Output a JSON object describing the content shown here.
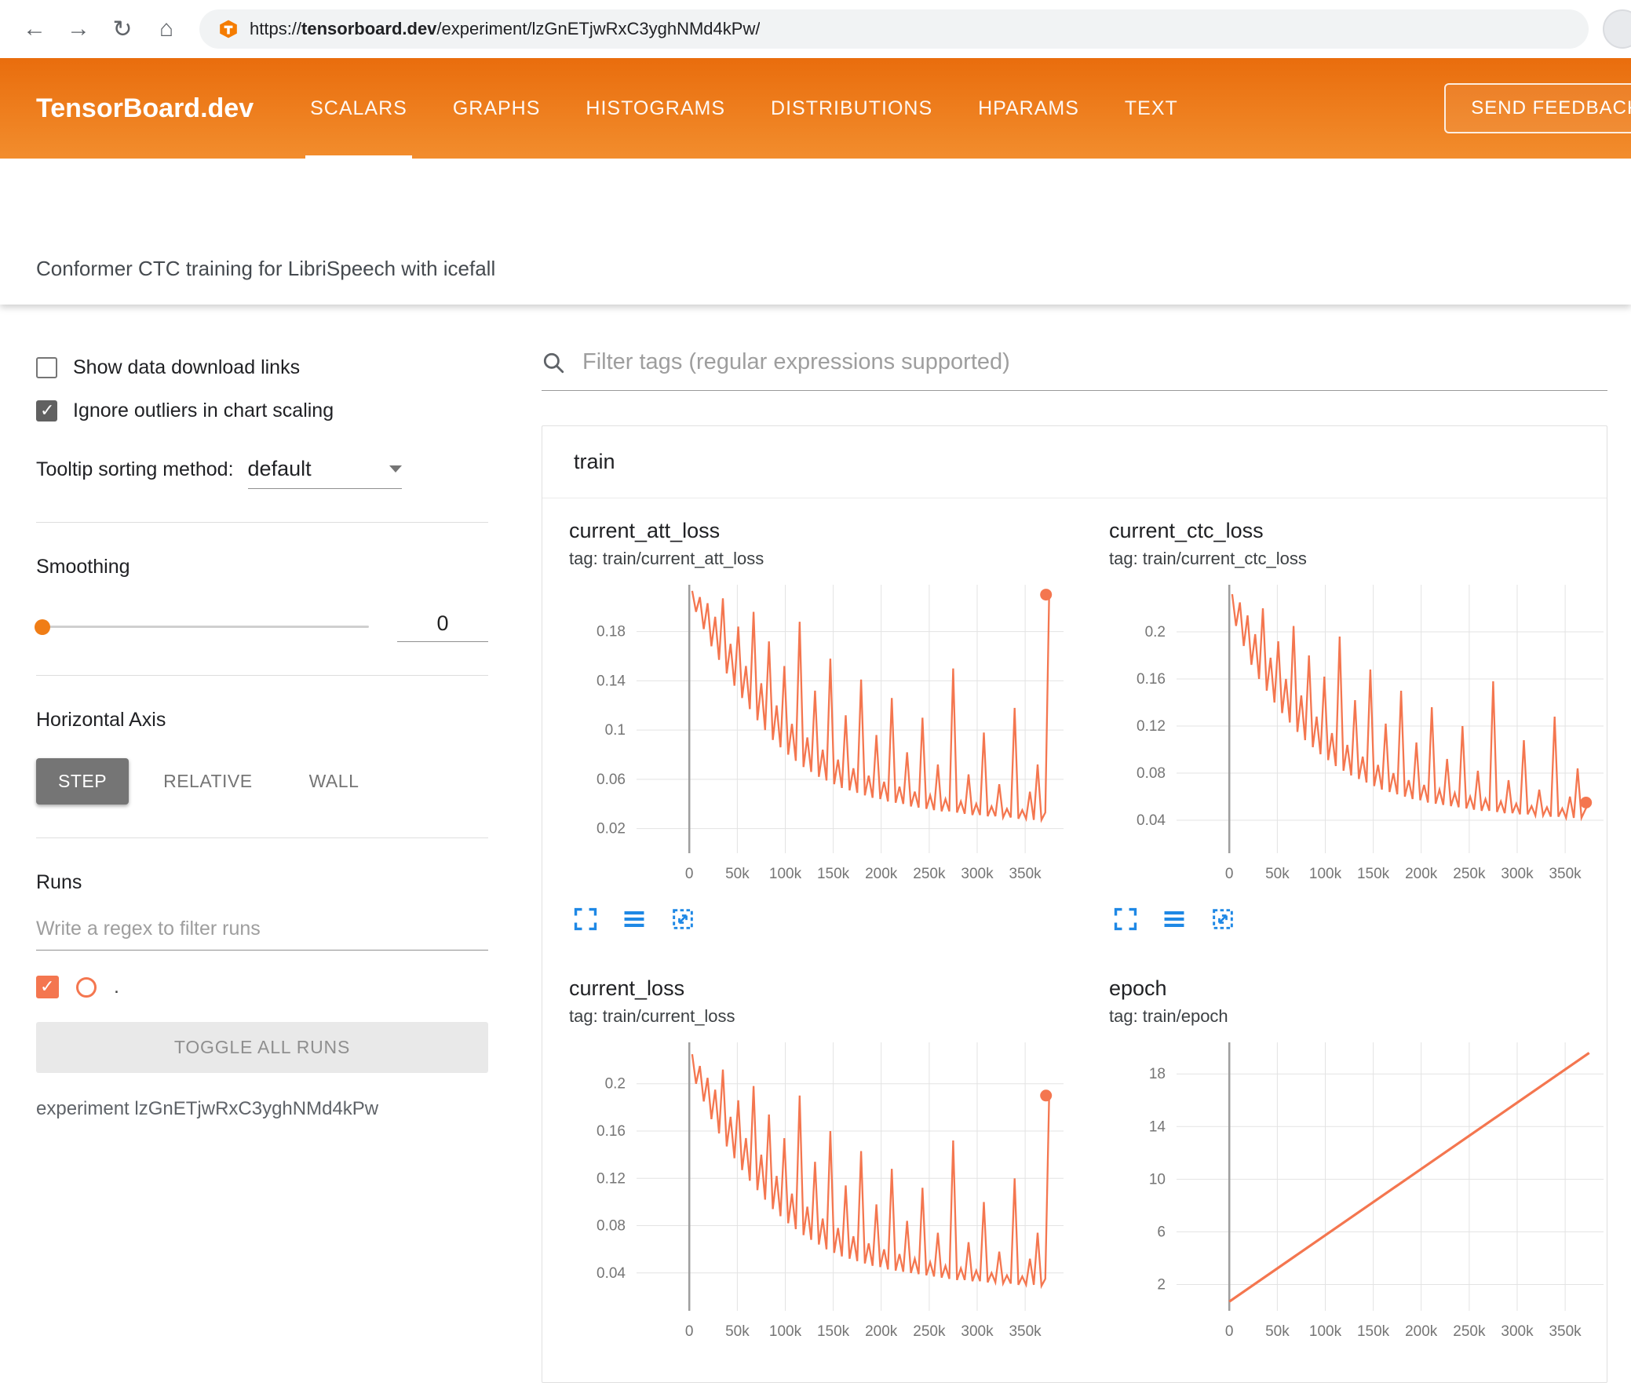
{
  "browser": {
    "back": "back",
    "forward": "forward",
    "reload": "reload",
    "home": "home",
    "url_scheme": "https://",
    "url_domain": "tensorboard.dev",
    "url_path": "/experiment/lzGnETjwRxC3yghNMd4kPw/"
  },
  "header": {
    "logo": "TensorBoard.dev",
    "tabs": [
      "SCALARS",
      "GRAPHS",
      "HISTOGRAMS",
      "DISTRIBUTIONS",
      "HPARAMS",
      "TEXT"
    ],
    "active_tab": "SCALARS",
    "feedback_label": "SEND FEEDBACK"
  },
  "subheader": {
    "title": "Conformer CTC training for LibriSpeech with icefall"
  },
  "sidebar": {
    "show_download_label": "Show data download links",
    "ignore_outliers_label": "Ignore outliers in chart scaling",
    "tooltip_label": "Tooltip sorting method:",
    "tooltip_value": "default",
    "smoothing_label": "Smoothing",
    "smoothing_value": "0",
    "horizontal_axis_label": "Horizontal Axis",
    "axis_buttons": [
      "STEP",
      "RELATIVE",
      "WALL"
    ],
    "active_axis": "STEP",
    "runs_label": "Runs",
    "runs_filter_placeholder": "Write a regex to filter runs",
    "run_item_label": ".",
    "toggle_button_label": "TOGGLE ALL RUNS",
    "experiment_caption": "experiment lzGnETjwRxC3yghNMd4kPw"
  },
  "main": {
    "filter_placeholder": "Filter tags (regular expressions supported)",
    "card_title": "train"
  },
  "colors": {
    "header_top": "#e96d0d",
    "header_bottom": "#f28d2d",
    "accent": "#f07d16",
    "line": "#f4764f",
    "icon_blue": "#1e88e5"
  },
  "chart_data": [
    {
      "type": "line",
      "title": "current_att_loss",
      "subtitle": "tag: train/current_att_loss",
      "x_start": 3000,
      "x_step": 4000,
      "y_values": [
        0.213,
        0.196,
        0.208,
        0.182,
        0.203,
        0.168,
        0.192,
        0.157,
        0.207,
        0.146,
        0.17,
        0.136,
        0.184,
        0.126,
        0.152,
        0.117,
        0.196,
        0.108,
        0.138,
        0.1,
        0.172,
        0.092,
        0.12,
        0.086,
        0.152,
        0.08,
        0.105,
        0.075,
        0.188,
        0.07,
        0.094,
        0.066,
        0.132,
        0.062,
        0.084,
        0.059,
        0.158,
        0.056,
        0.076,
        0.053,
        0.112,
        0.051,
        0.069,
        0.049,
        0.141,
        0.047,
        0.063,
        0.045,
        0.096,
        0.044,
        0.058,
        0.042,
        0.126,
        0.041,
        0.054,
        0.04,
        0.082,
        0.038,
        0.05,
        0.037,
        0.11,
        0.036,
        0.047,
        0.035,
        0.072,
        0.034,
        0.044,
        0.034,
        0.15,
        0.033,
        0.042,
        0.032,
        0.064,
        0.031,
        0.04,
        0.031,
        0.098,
        0.03,
        0.038,
        0.03,
        0.056,
        0.029,
        0.036,
        0.029,
        0.118,
        0.028,
        0.035,
        0.028,
        0.05,
        0.027,
        0.072,
        0.027,
        0.033,
        0.21
      ],
      "x_domain": [
        -55000,
        390000
      ],
      "y_domain": [
        0,
        0.218
      ],
      "x_ticks": {
        "values": [
          0,
          50000,
          100000,
          150000,
          200000,
          250000,
          300000,
          350000
        ],
        "labels": [
          "0",
          "50k",
          "100k",
          "150k",
          "200k",
          "250k",
          "300k",
          "350k"
        ]
      },
      "y_ticks": {
        "values": [
          0.02,
          0.06,
          0.1,
          0.14,
          0.18
        ],
        "labels": [
          "0.02",
          "0.06",
          "0.1",
          "0.14",
          "0.18"
        ]
      },
      "end_dot": true
    },
    {
      "type": "line",
      "title": "current_ctc_loss",
      "subtitle": "tag: train/current_ctc_loss",
      "x_start": 3000,
      "x_step": 4000,
      "y_values": [
        0.232,
        0.205,
        0.225,
        0.188,
        0.214,
        0.172,
        0.198,
        0.16,
        0.22,
        0.15,
        0.178,
        0.14,
        0.192,
        0.131,
        0.16,
        0.123,
        0.205,
        0.115,
        0.146,
        0.108,
        0.18,
        0.102,
        0.128,
        0.096,
        0.162,
        0.091,
        0.114,
        0.086,
        0.196,
        0.082,
        0.104,
        0.078,
        0.142,
        0.075,
        0.094,
        0.072,
        0.168,
        0.069,
        0.087,
        0.066,
        0.122,
        0.064,
        0.08,
        0.062,
        0.15,
        0.06,
        0.074,
        0.058,
        0.106,
        0.057,
        0.07,
        0.055,
        0.136,
        0.054,
        0.066,
        0.053,
        0.092,
        0.052,
        0.063,
        0.051,
        0.12,
        0.05,
        0.06,
        0.049,
        0.082,
        0.048,
        0.058,
        0.048,
        0.158,
        0.047,
        0.056,
        0.046,
        0.074,
        0.046,
        0.054,
        0.045,
        0.108,
        0.045,
        0.052,
        0.044,
        0.066,
        0.044,
        0.051,
        0.043,
        0.128,
        0.043,
        0.05,
        0.042,
        0.06,
        0.042,
        0.084,
        0.042,
        0.049,
        0.055
      ],
      "x_domain": [
        -55000,
        390000
      ],
      "y_domain": [
        0.012,
        0.24
      ],
      "x_ticks": {
        "values": [
          0,
          50000,
          100000,
          150000,
          200000,
          250000,
          300000,
          350000
        ],
        "labels": [
          "0",
          "50k",
          "100k",
          "150k",
          "200k",
          "250k",
          "300k",
          "350k"
        ]
      },
      "y_ticks": {
        "values": [
          0.04,
          0.08,
          0.12,
          0.16,
          0.2
        ],
        "labels": [
          "0.04",
          "0.08",
          "0.12",
          "0.16",
          "0.2"
        ]
      },
      "end_dot": true
    },
    {
      "type": "line",
      "title": "current_loss",
      "subtitle": "tag: train/current_loss",
      "x_start": 3000,
      "x_step": 4000,
      "y_values": [
        0.225,
        0.2,
        0.215,
        0.185,
        0.205,
        0.17,
        0.195,
        0.158,
        0.212,
        0.147,
        0.172,
        0.137,
        0.186,
        0.127,
        0.154,
        0.118,
        0.198,
        0.11,
        0.14,
        0.102,
        0.174,
        0.094,
        0.122,
        0.088,
        0.154,
        0.082,
        0.107,
        0.077,
        0.19,
        0.072,
        0.096,
        0.068,
        0.134,
        0.064,
        0.086,
        0.06,
        0.16,
        0.057,
        0.078,
        0.054,
        0.114,
        0.052,
        0.071,
        0.05,
        0.143,
        0.048,
        0.065,
        0.046,
        0.098,
        0.045,
        0.06,
        0.043,
        0.128,
        0.042,
        0.056,
        0.041,
        0.084,
        0.04,
        0.052,
        0.039,
        0.112,
        0.038,
        0.049,
        0.037,
        0.074,
        0.036,
        0.046,
        0.035,
        0.152,
        0.034,
        0.044,
        0.034,
        0.066,
        0.033,
        0.042,
        0.033,
        0.1,
        0.032,
        0.04,
        0.032,
        0.058,
        0.031,
        0.038,
        0.031,
        0.12,
        0.03,
        0.037,
        0.03,
        0.052,
        0.03,
        0.074,
        0.029,
        0.035,
        0.19
      ],
      "x_domain": [
        -55000,
        390000
      ],
      "y_domain": [
        0.008,
        0.235
      ],
      "x_ticks": {
        "values": [
          0,
          50000,
          100000,
          150000,
          200000,
          250000,
          300000,
          350000
        ],
        "labels": [
          "0",
          "50k",
          "100k",
          "150k",
          "200k",
          "250k",
          "300k",
          "350k"
        ]
      },
      "y_ticks": {
        "values": [
          0.04,
          0.08,
          0.12,
          0.16,
          0.2
        ],
        "labels": [
          "0.04",
          "0.08",
          "0.12",
          "0.16",
          "0.2"
        ]
      },
      "end_dot": true
    },
    {
      "type": "line",
      "title": "epoch",
      "subtitle": "tag: train/epoch",
      "x_start": 0,
      "x_step": 375000,
      "y_values": [
        0.7,
        19.6
      ],
      "x_domain": [
        -55000,
        390000
      ],
      "y_domain": [
        0,
        20.4
      ],
      "x_ticks": {
        "values": [
          0,
          50000,
          100000,
          150000,
          200000,
          250000,
          300000,
          350000
        ],
        "labels": [
          "0",
          "50k",
          "100k",
          "150k",
          "200k",
          "250k",
          "300k",
          "350k"
        ]
      },
      "y_ticks": {
        "values": [
          2,
          6,
          10,
          14,
          18
        ],
        "labels": [
          "2",
          "6",
          "10",
          "14",
          "18"
        ]
      },
      "end_dot": false
    }
  ]
}
